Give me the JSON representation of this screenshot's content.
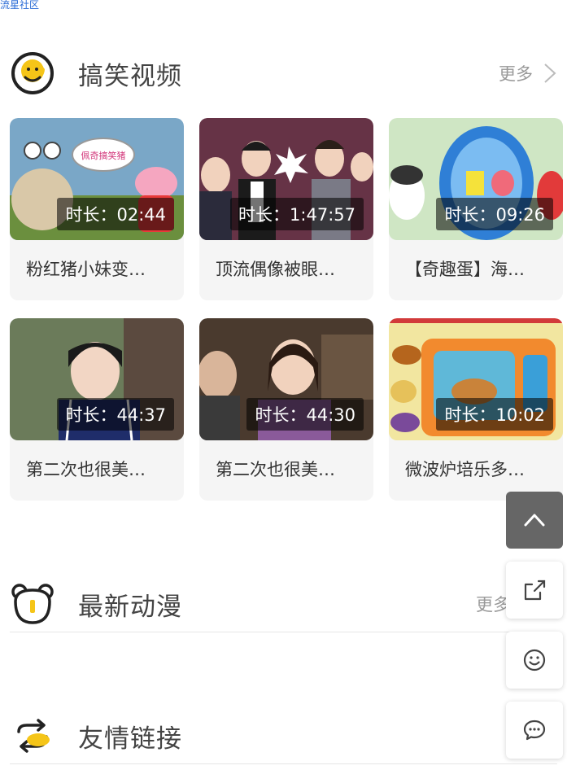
{
  "top_link": "流星社区",
  "sections": {
    "funny_videos": {
      "title": "搞笑视频",
      "more": "更多"
    },
    "latest_anime": {
      "title": "最新动漫",
      "more": "更多"
    },
    "friend_links": {
      "title": "友情链接"
    }
  },
  "videos": [
    {
      "duration": "时长：02:44",
      "title": "粉红猪小妹变…"
    },
    {
      "duration": "时长：1:47:57",
      "title": "顶流偶像被眼…"
    },
    {
      "duration": "时长：09:26",
      "title": "【奇趣蛋】海…"
    },
    {
      "duration": "时长：44:37",
      "title": "第二次也很美…"
    },
    {
      "duration": "时长：44:30",
      "title": "第二次也很美…"
    },
    {
      "duration": "时长：10:02",
      "title": "微波炉培乐多…"
    }
  ],
  "floating_buttons": [
    "back-to-top-icon",
    "share-icon",
    "smiley-icon",
    "chat-icon"
  ],
  "colors": {
    "accent_yellow": "#f5c518",
    "link_blue": "#2a6bd6"
  }
}
